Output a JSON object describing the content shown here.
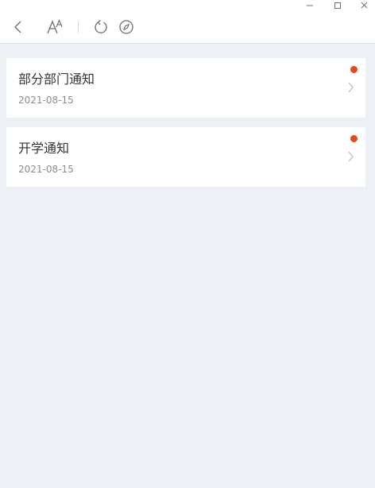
{
  "colors": {
    "background": "#edf0f5",
    "card": "#ffffff",
    "unread_dot": "#e8471c",
    "title_text": "#333333",
    "date_text": "#8a8d93",
    "icon": "#6b6e73"
  },
  "window_controls": [
    "minimize-icon",
    "maximize-icon",
    "close-icon"
  ],
  "toolbar": {
    "icons": [
      "back-arrow-icon",
      "font-size-icon",
      "refresh-icon",
      "compass-icon"
    ]
  },
  "notices": [
    {
      "title": "部分部门通知",
      "date": "2021-08-15",
      "unread": true
    },
    {
      "title": "开学通知",
      "date": "2021-08-15",
      "unread": true
    }
  ]
}
